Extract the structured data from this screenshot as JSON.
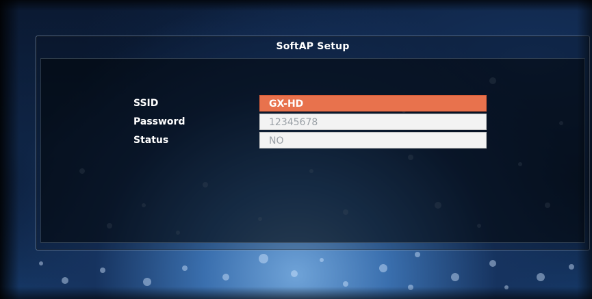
{
  "dialog": {
    "title": "SoftAP Setup"
  },
  "settings": [
    {
      "label": "SSID",
      "value": "GX-HD",
      "selected": true
    },
    {
      "label": "Password",
      "value": "12345678",
      "selected": false
    },
    {
      "label": "Status",
      "value": "NO",
      "selected": false
    }
  ],
  "colors": {
    "selected_field": "#e8724d",
    "field_background": "#f3f3f3",
    "field_text": "#9aa0a6",
    "label_text": "#ffffff"
  }
}
